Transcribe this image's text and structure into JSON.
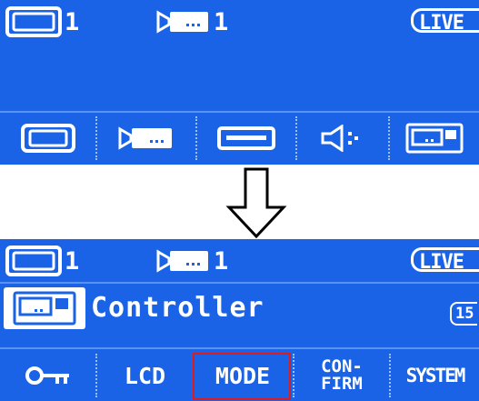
{
  "top_screen": {
    "status": {
      "monitor_number": "1",
      "camera_number": "1",
      "live_label": "LIVE"
    },
    "buttons": [
      {
        "icon": "monitor-icon"
      },
      {
        "icon": "camera-icon"
      },
      {
        "icon": "recorder-icon"
      },
      {
        "icon": "speaker-icon"
      },
      {
        "icon": "controller-icon"
      }
    ]
  },
  "bottom_screen": {
    "status": {
      "monitor_number": "1",
      "camera_number": "1",
      "live_label": "LIVE"
    },
    "menu": {
      "icon": "controller-icon",
      "title": "Controller",
      "count": "15"
    },
    "softkeys": {
      "key_icon": "key-icon",
      "lcd": "LCD",
      "mode": "MODE",
      "confirm_line1": "CON-",
      "confirm_line2": "FIRM",
      "system": "SYSTEM"
    },
    "highlighted_softkey": "MODE",
    "highlight_color": "#e11b1b"
  },
  "colors": {
    "screen_bg": "#1a63e6",
    "foreground": "#ffffff"
  },
  "arrow_icon": "down-arrow-icon"
}
